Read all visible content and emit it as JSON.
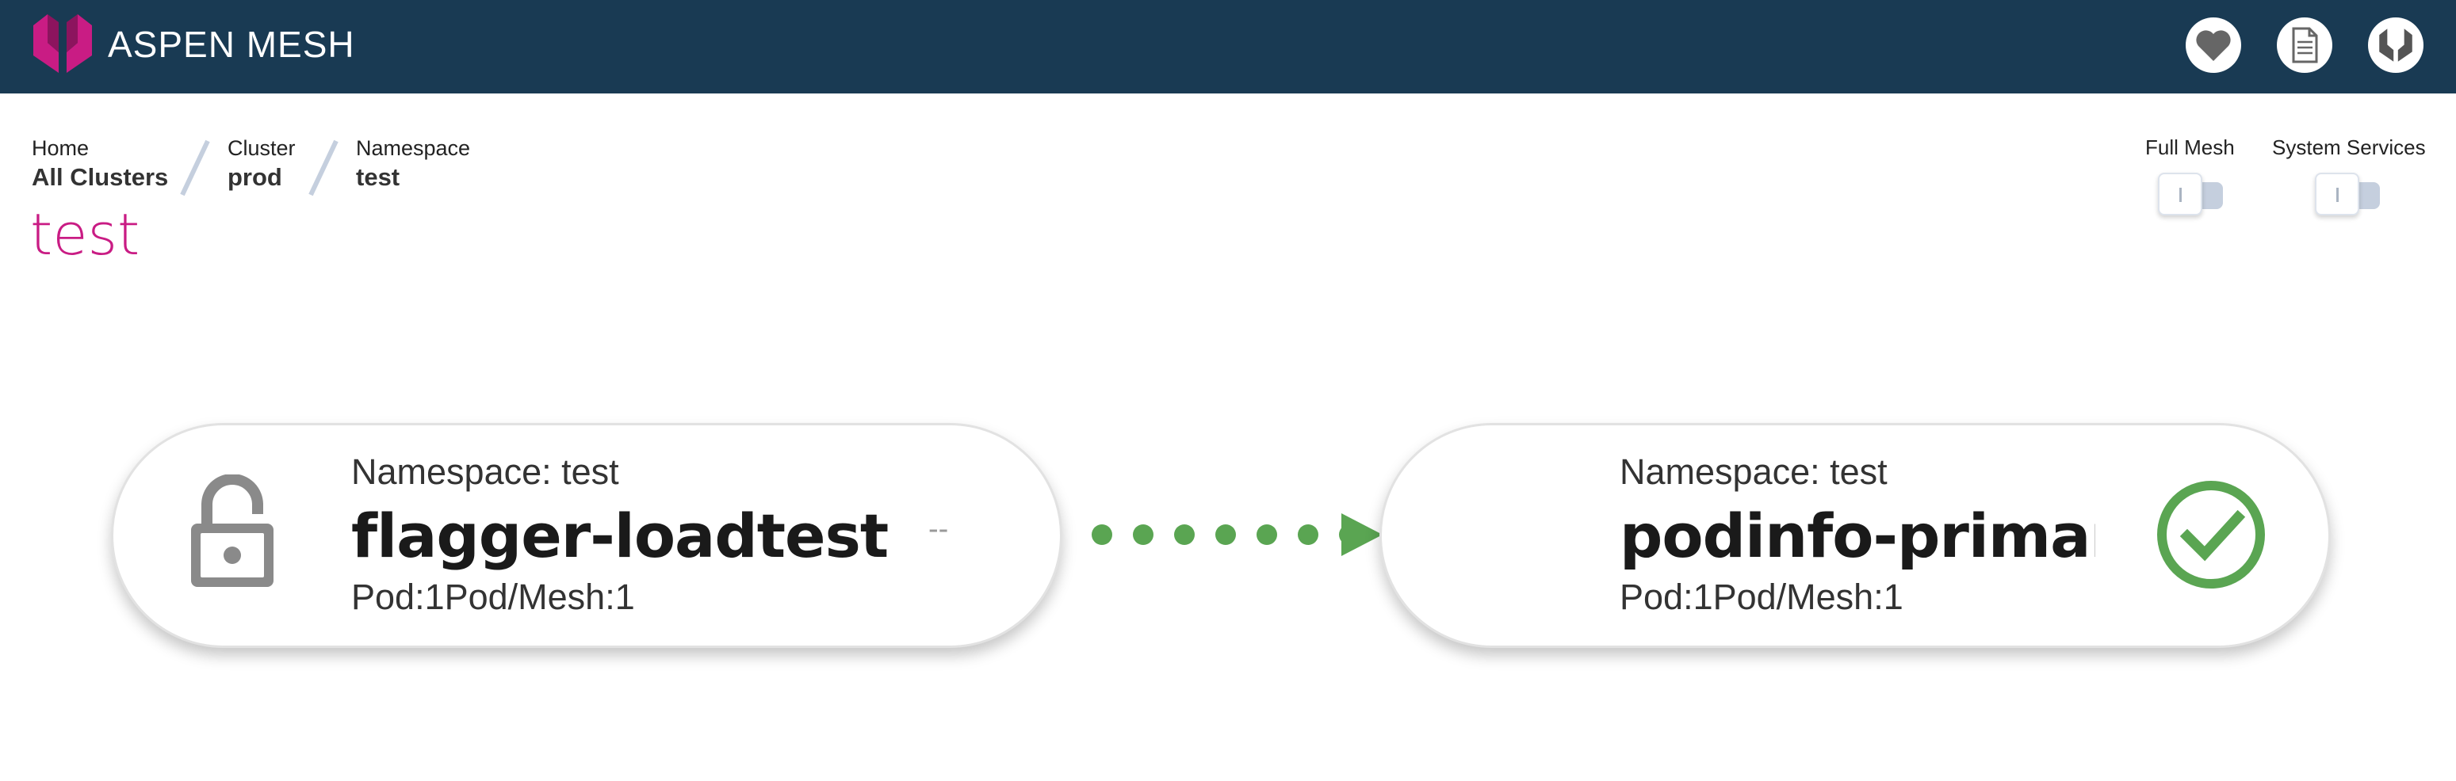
{
  "header": {
    "brand": "ASPEN MESH",
    "icons": [
      "heart-icon",
      "document-icon",
      "aspen-logo-icon"
    ]
  },
  "breadcrumb": [
    {
      "label": "Home",
      "value": "All Clusters"
    },
    {
      "label": "Cluster",
      "value": "prod"
    },
    {
      "label": "Namespace",
      "value": "test"
    }
  ],
  "page_title": "test",
  "toggles": [
    {
      "label": "Full Mesh",
      "on": false
    },
    {
      "label": "System Services",
      "on": false
    }
  ],
  "graph": {
    "nodes": [
      {
        "namespace": "Namespace: test",
        "name": "flagger-loadtest",
        "pods": "Pod:1Pod/Mesh:1",
        "icon": "unlocked-icon",
        "extra": "--"
      },
      {
        "namespace": "Namespace: test",
        "name": "podinfo-primary",
        "pods": "Pod:1Pod/Mesh:1",
        "icon": "healthy-check-icon"
      }
    ],
    "edge_color": "#5aa552"
  },
  "colors": {
    "header_bg": "#193a53",
    "brand_accent": "#c91c84",
    "healthy": "#5aa552"
  }
}
